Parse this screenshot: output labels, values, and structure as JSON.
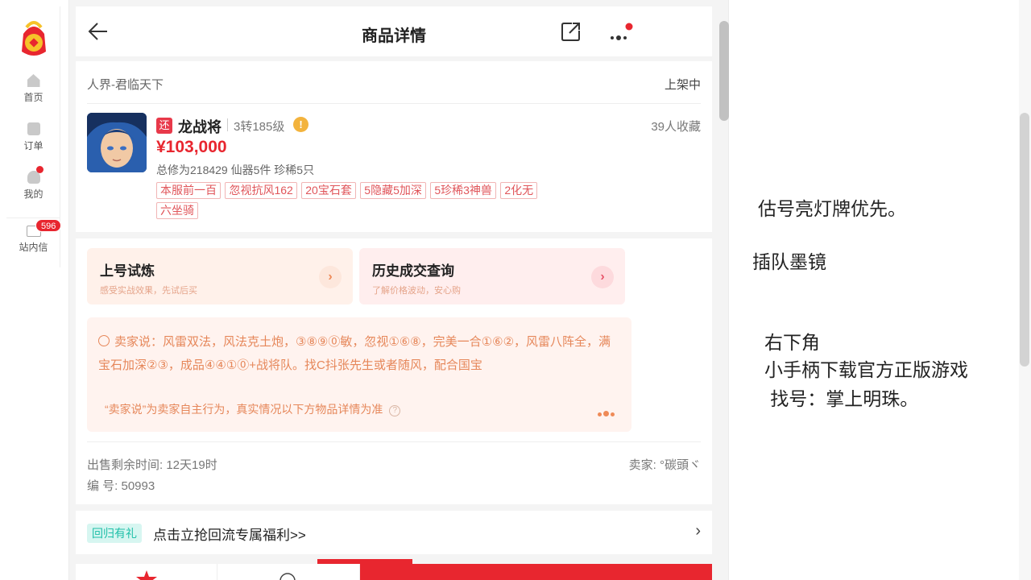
{
  "left_nav": {
    "items": [
      {
        "label": "首页"
      },
      {
        "label": "订单"
      },
      {
        "label": "我的"
      },
      {
        "label": "站内信"
      }
    ],
    "message_count": "596"
  },
  "header": {
    "title": "商品详情"
  },
  "product": {
    "server": "人界-君临天下",
    "status": "上架中",
    "tag_badge": "还",
    "name": "龙战将",
    "level": "3转185级",
    "favorites": "39人收藏",
    "price": "¥103,000",
    "stats": "总修为218429  仙器5件  珍稀5只",
    "tags": [
      "本服前一百",
      "忽视抗风162",
      "20宝石套",
      "5隐藏5加深",
      "5珍稀3神兽",
      "2化无",
      "六坐骑"
    ]
  },
  "promos": [
    {
      "title": "上号试炼",
      "subtitle": "感受实战效果，先试后买"
    },
    {
      "title": "历史成交查询",
      "subtitle": "了解价格波动，安心购"
    }
  ],
  "seller_says": {
    "text": "卖家说：风雷双法，风法克土炮，③⑧⑨⓪敏，忽视①⑥⑧，完美一合①⑥②，风雷八阵全，满宝石加深②③，成品④④①⓪+战将队。找C抖张先生或者随风，配合国宝",
    "note": "“卖家说”为卖家自主行为，真实情况以下方物品详情为准"
  },
  "meta": {
    "remaining": "出售剩余时间: 12天19时",
    "seller": "卖家: °碳頭ヾ",
    "serial": "编 号: 50993"
  },
  "return_gift": {
    "tag": "回归有礼",
    "text": "点击立抢回流专属福利>>"
  },
  "notes": {
    "line1": "估号亮灯牌优先。",
    "line2": "插队墨镜",
    "line3": "右下角",
    "line4": "小手柄下载官方正版游戏",
    "line5": " 找号：掌上明珠。"
  }
}
